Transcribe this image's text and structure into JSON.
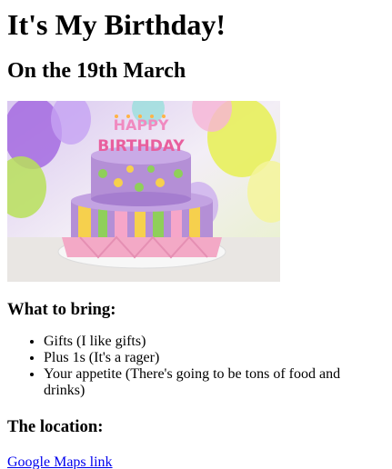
{
  "title": "It's My Birthday!",
  "subtitle": "On the 19th March",
  "image": {
    "cake_text": "HAPPY BIRTHDAY",
    "colors": {
      "cake_purple": "#b48fd6",
      "cake_pink": "#f6a6c9",
      "cake_yellow": "#f6d04d",
      "cake_green": "#8fcf5a",
      "ribbon_pink": "#f3a9c6",
      "plate": "#f2f2f2"
    }
  },
  "bring": {
    "heading": "What to bring:",
    "items": [
      "Gifts (I like gifts)",
      "Plus 1s (It's a rager)",
      "Your appetite (There's going to be tons of food and drinks)"
    ]
  },
  "location": {
    "heading": "The location:",
    "link_label": "Google Maps link"
  }
}
